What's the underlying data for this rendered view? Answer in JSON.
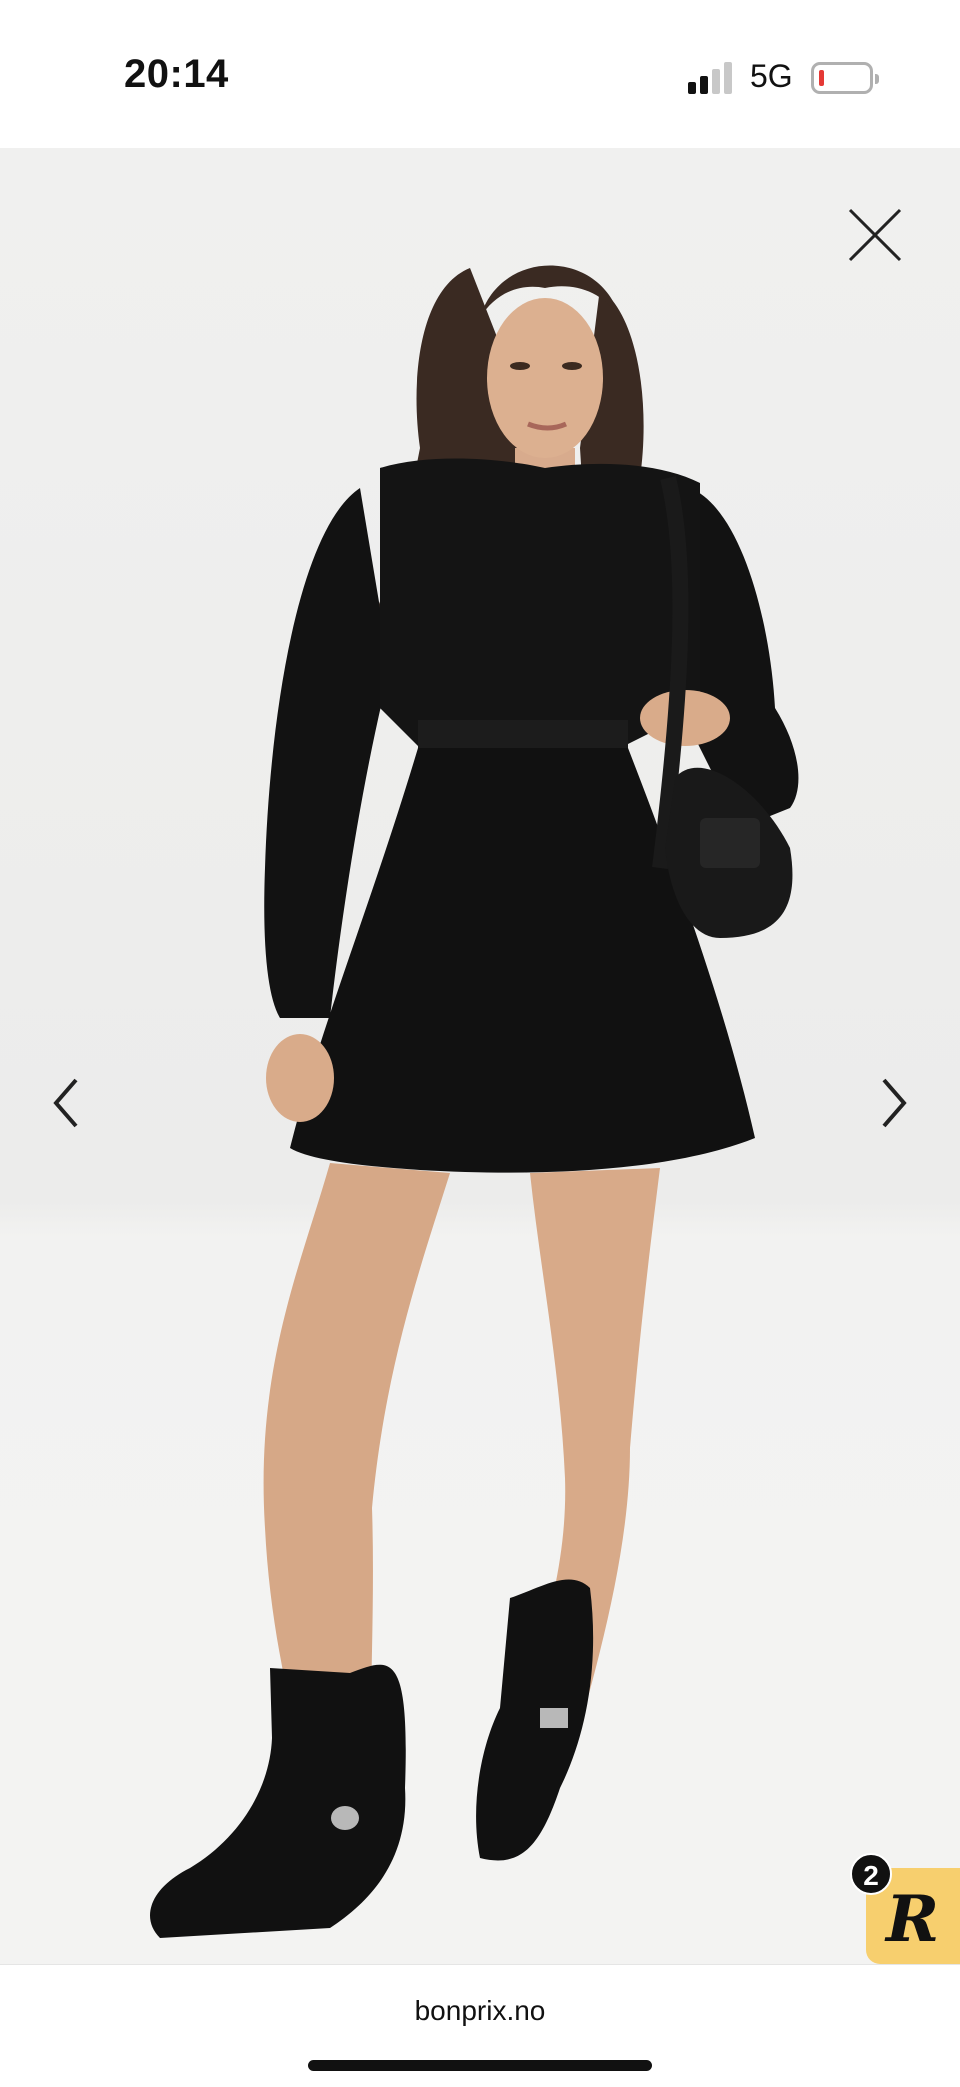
{
  "status_bar": {
    "time": "20:14",
    "network": "5G",
    "signal_bars_active": 2,
    "signal_bars_total": 4,
    "battery_level": 0.08,
    "battery_color": "#e53935"
  },
  "viewer": {
    "close_icon": "close-icon",
    "prev_icon": "chevron-left-icon",
    "next_icon": "chevron-right-icon"
  },
  "floating_badge": {
    "count": "2",
    "letter": "R",
    "color": "#f7cf6e"
  },
  "browser": {
    "url": "bonprix.no"
  }
}
